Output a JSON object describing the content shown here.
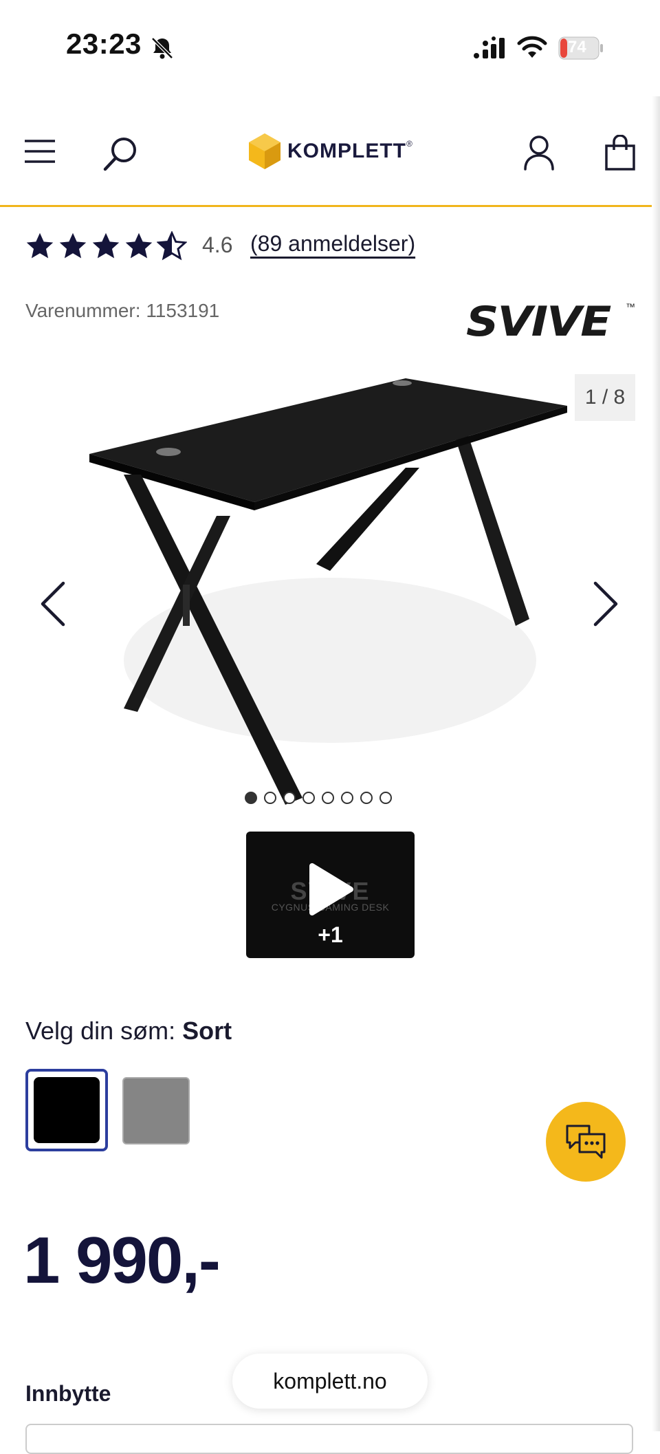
{
  "status_bar": {
    "time": "23:23",
    "battery": "74"
  },
  "header": {
    "logo_text": "KOMPLETT",
    "logo_reg": "®"
  },
  "product": {
    "rating": "4.6",
    "reviews_link": "(89 anmeldelser)",
    "stars_filled": 4.5,
    "stars_total": 5,
    "sku": "Varenummer: 1153191",
    "brand": "SVIVE",
    "brand_tm": "™"
  },
  "gallery": {
    "counter": "1 / 8",
    "total_images": 8,
    "active_index": 0,
    "video": {
      "brand_text": "SVIVE",
      "caption": "CYGNUS GAMING DESK",
      "count": "+1"
    }
  },
  "variant": {
    "label": "Velg din søm: ",
    "selected": "Sort",
    "options": [
      {
        "name": "Sort",
        "color": "#000000"
      },
      {
        "name": "Grå",
        "color": "#858585"
      }
    ]
  },
  "price": "1 990,-",
  "trade_in": {
    "label": "Innbytte"
  },
  "browser": {
    "url": "komplett.no"
  },
  "colors": {
    "accent": "#f1b51c",
    "chat_button": "#f4b81b",
    "selected_border": "#2c3e9e",
    "primary_text": "#14143a"
  }
}
